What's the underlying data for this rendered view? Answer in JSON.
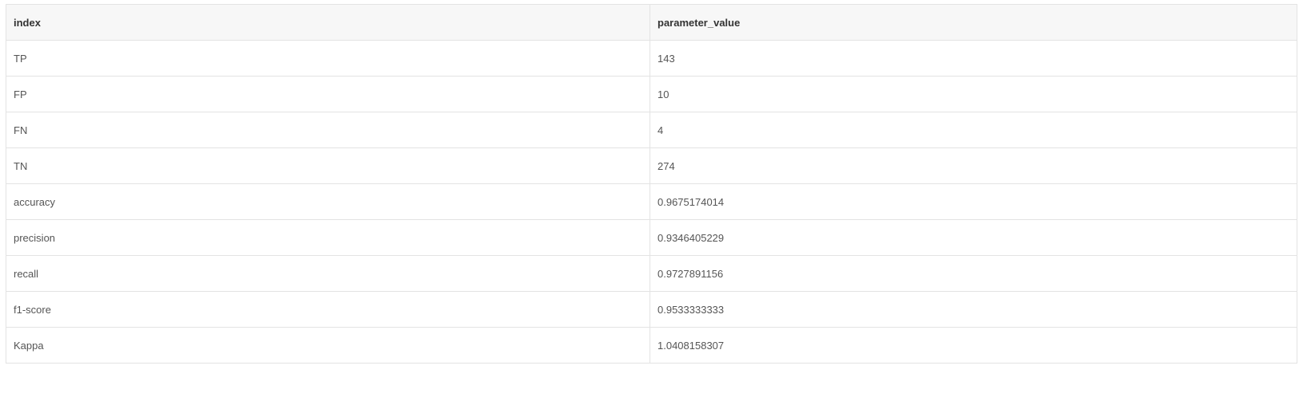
{
  "table": {
    "columns": [
      "index",
      "parameter_value"
    ],
    "rows": [
      {
        "index": "TP",
        "parameter_value": "143"
      },
      {
        "index": "FP",
        "parameter_value": "10"
      },
      {
        "index": "FN",
        "parameter_value": "4"
      },
      {
        "index": "TN",
        "parameter_value": "274"
      },
      {
        "index": "accuracy",
        "parameter_value": "0.9675174014"
      },
      {
        "index": "precision",
        "parameter_value": "0.9346405229"
      },
      {
        "index": "recall",
        "parameter_value": "0.9727891156"
      },
      {
        "index": "f1-score",
        "parameter_value": "0.9533333333"
      },
      {
        "index": "Kappa",
        "parameter_value": "1.0408158307"
      }
    ]
  }
}
